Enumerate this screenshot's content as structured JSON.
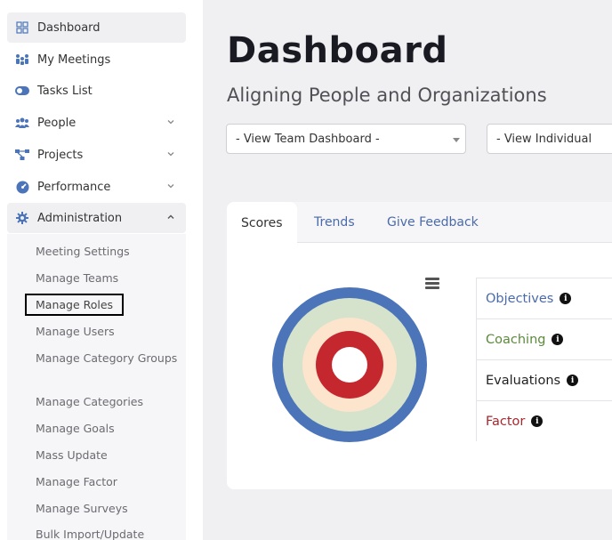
{
  "sidebar": {
    "items": [
      {
        "label": "Dashboard",
        "icon": "grid-icon"
      },
      {
        "label": "My Meetings",
        "icon": "meeting-icon"
      },
      {
        "label": "Tasks List",
        "icon": "toggle-icon"
      },
      {
        "label": "People",
        "icon": "people-icon"
      },
      {
        "label": "Projects",
        "icon": "project-icon"
      },
      {
        "label": "Performance",
        "icon": "gauge-icon"
      },
      {
        "label": "Administration",
        "icon": "gear-icon"
      }
    ],
    "admin_sub": [
      "Meeting Settings",
      "Manage Teams",
      "Manage Roles",
      "Manage Users",
      "Manage Category Groups",
      "Manage Categories",
      "Manage Goals",
      "Mass Update",
      "Manage Factor",
      "Manage Surveys",
      "Bulk Import/Update"
    ]
  },
  "main": {
    "title": "Dashboard",
    "subtitle": "Aligning People and Organizations",
    "team_select": "- View Team Dashboard -",
    "individual_select": "- View Individual",
    "tabs": [
      "Scores",
      "Trends",
      "Give Feedback"
    ],
    "legend": [
      {
        "label": "Objectives",
        "color": "#4a6aa8"
      },
      {
        "label": "Coaching",
        "color": "#5b8a3c"
      },
      {
        "label": "Evaluations",
        "color": "#222222"
      },
      {
        "label": "Factor",
        "color": "#a8282e"
      }
    ],
    "info_glyph": "i"
  },
  "colors": {
    "ring_outer": "#4b74b9",
    "ring_second": "#d5e3cc",
    "ring_third": "#fde4cc",
    "ring_inner": "#c4282e",
    "accent": "#4a6aa8"
  }
}
